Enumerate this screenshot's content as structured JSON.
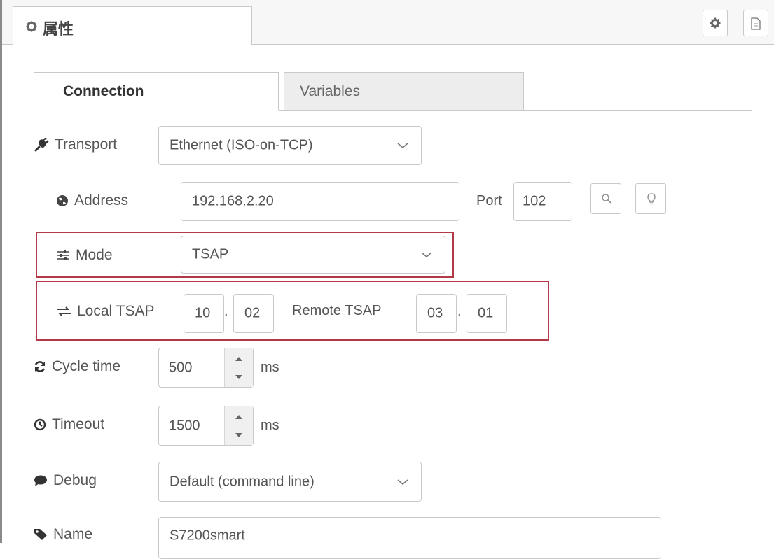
{
  "header": {
    "panel_title": "属性",
    "icons": [
      "gear-icon",
      "document-icon"
    ]
  },
  "tabs": [
    {
      "label": "Connection",
      "active": true
    },
    {
      "label": "Variables",
      "active": false
    }
  ],
  "fields": {
    "transport": {
      "label": "Transport",
      "icon": "plug-icon",
      "value": "Ethernet (ISO-on-TCP)"
    },
    "address": {
      "label": "Address",
      "icon": "globe-icon",
      "value": "192.168.2.20",
      "port_label": "Port",
      "port_value": "102"
    },
    "mode": {
      "label": "Mode",
      "icon": "sliders-icon",
      "value": "TSAP"
    },
    "tsap": {
      "local_label": "Local TSAP",
      "icon": "exchange-icon",
      "local_1": "10",
      "local_2": "02",
      "remote_label": "Remote TSAP",
      "remote_1": "03",
      "remote_2": "01",
      "separator": "."
    },
    "cycle_time": {
      "label": "Cycle time",
      "icon": "refresh-icon",
      "value": "500",
      "unit": "ms"
    },
    "timeout": {
      "label": "Timeout",
      "icon": "clock-icon",
      "value": "1500",
      "unit": "ms"
    },
    "debug": {
      "label": "Debug",
      "icon": "comment-icon",
      "value": "Default (command line)"
    },
    "name": {
      "label": "Name",
      "icon": "tag-icon",
      "value": "S7200smart"
    }
  },
  "colors": {
    "highlight_border": "#b23a48"
  }
}
